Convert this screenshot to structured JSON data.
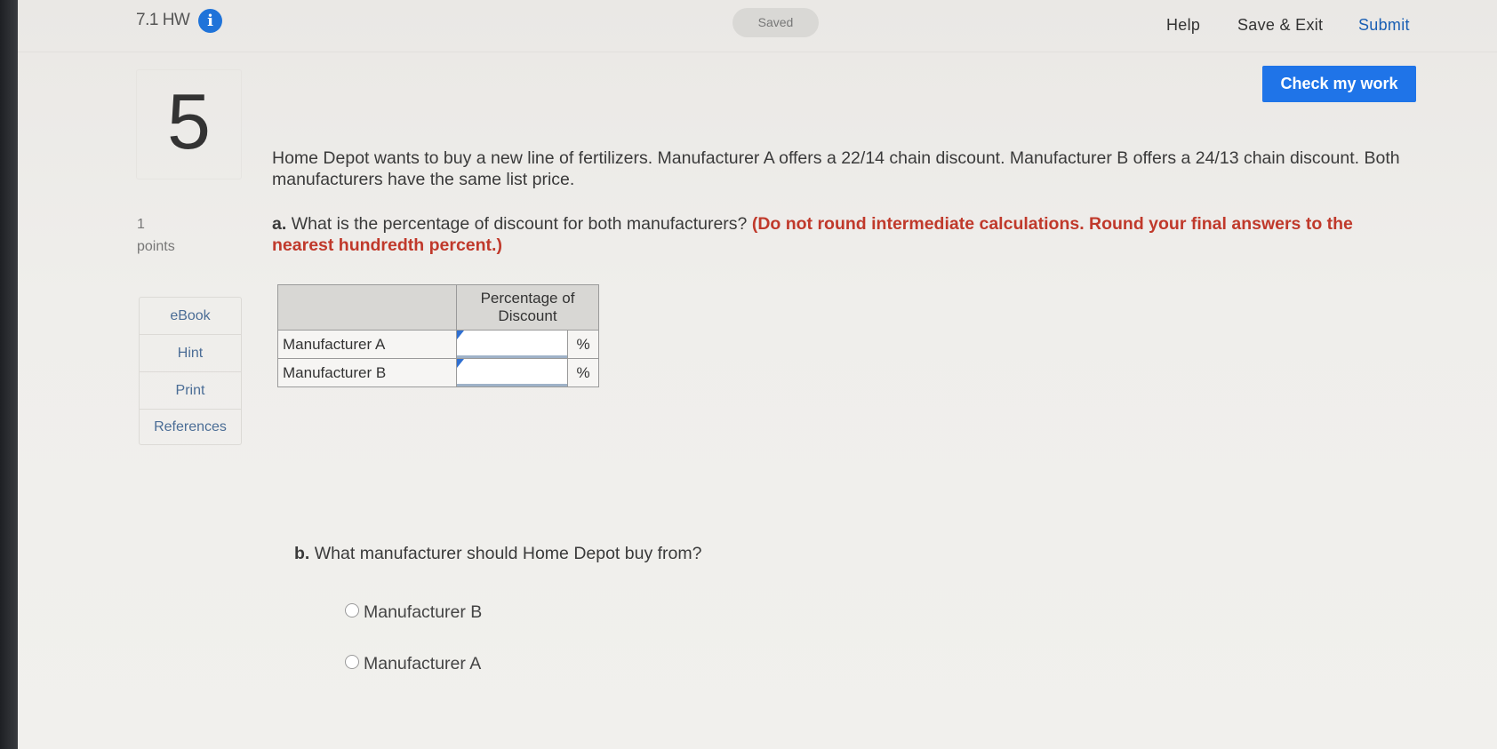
{
  "header": {
    "assignment_title": "7.1 HW",
    "info_icon": "info-icon",
    "status": "Saved",
    "nav": {
      "help": "Help",
      "save_exit": "Save & Exit",
      "submit": "Submit"
    },
    "check_my_work": "Check my work"
  },
  "question": {
    "number": "5",
    "points_value": "1",
    "points_label": "points",
    "tools": [
      "eBook",
      "Hint",
      "Print",
      "References"
    ],
    "problem_text": "Home Depot wants to buy a new line of fertilizers. Manufacturer A offers a 22/14 chain discount. Manufacturer B offers a 24/13 chain discount. Both manufacturers have the same list price.",
    "part_a": {
      "label": "a.",
      "text": "What is the percentage of discount for both manufacturers?",
      "instruction": "(Do not round intermediate calculations. Round your final answers to the nearest hundredth percent.)"
    },
    "table": {
      "header": "Percentage of Discount",
      "rows": [
        {
          "label": "Manufacturer A",
          "value": "",
          "unit": "%"
        },
        {
          "label": "Manufacturer B",
          "value": "",
          "unit": "%"
        }
      ]
    },
    "part_b": {
      "label": "b.",
      "text": "What manufacturer should Home Depot buy from?",
      "options": [
        "Manufacturer B",
        "Manufacturer A"
      ]
    }
  },
  "colors": {
    "accent": "#1f74e8",
    "instruction_red": "#c0392b",
    "link_blue": "#4b6d96"
  }
}
